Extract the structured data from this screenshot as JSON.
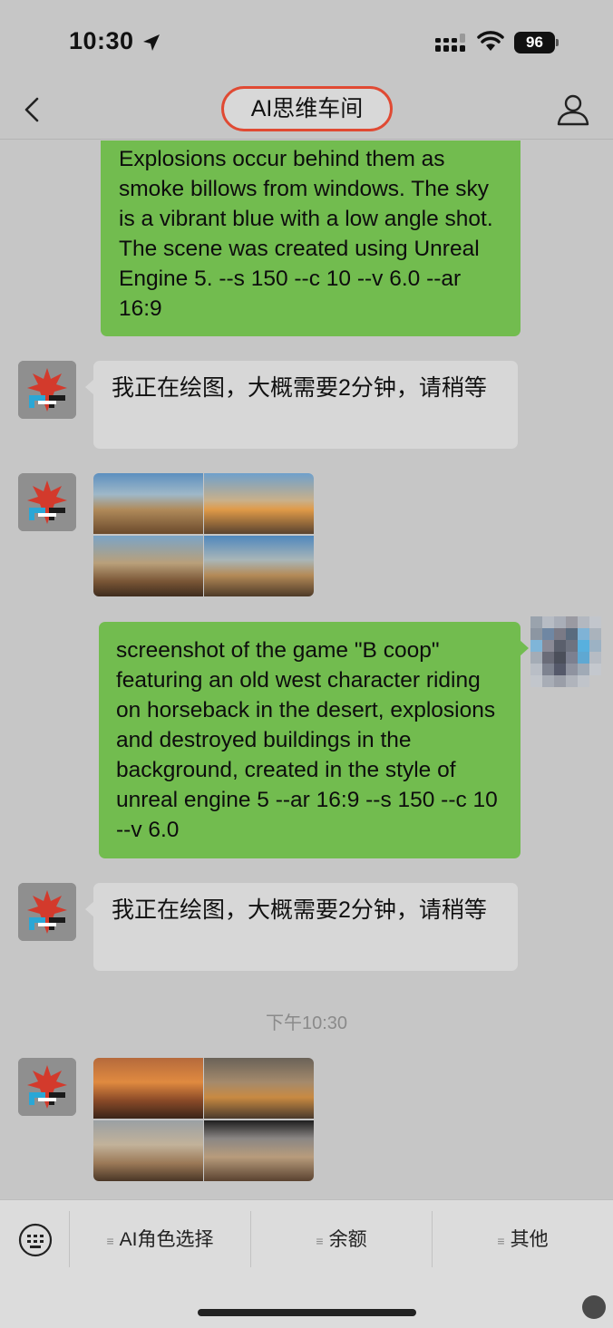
{
  "status_bar": {
    "time": "10:30",
    "battery": "96"
  },
  "nav": {
    "title": "AI思维车间"
  },
  "messages": [
    {
      "from": "user",
      "text": "Explosions occur behind them as smoke billows from windows. The sky is a vibrant blue with a low angle shot. The scene was created using Unreal Engine 5. --s 150 --c 10 --v 6.0 --ar 16:9"
    },
    {
      "from": "bot",
      "text": "我正在绘图，大概需要2分钟，请稍等"
    },
    {
      "from": "bot",
      "type": "image-grid",
      "style": "western blue-sky explosions"
    },
    {
      "from": "user",
      "text": "screenshot of the game \"B coop\" featuring an old west character riding on horseback in the desert, explosions and destroyed buildings in the background, created in the style of unreal engine 5 --ar 16:9 --s 150 --c 10 --v 6.0"
    },
    {
      "from": "bot",
      "text": "我正在绘图，大概需要2分钟，请稍等"
    },
    {
      "from": "bot",
      "type": "image-grid",
      "style": "western desert horseback sunset"
    }
  ],
  "timestamp": "下午10:30",
  "menu": {
    "items": [
      "AI角色选择",
      "余额",
      "其他"
    ]
  },
  "icons": {
    "back": "chevron-left-icon",
    "profile": "person-icon",
    "keyboard": "keyboard-icon",
    "menu_glyph": "list-icon"
  },
  "colors": {
    "user_bubble": "#72bc4f",
    "bot_bubble": "#d7d7d7",
    "background": "#c6c6c6",
    "title_highlight": "#e04a33"
  }
}
